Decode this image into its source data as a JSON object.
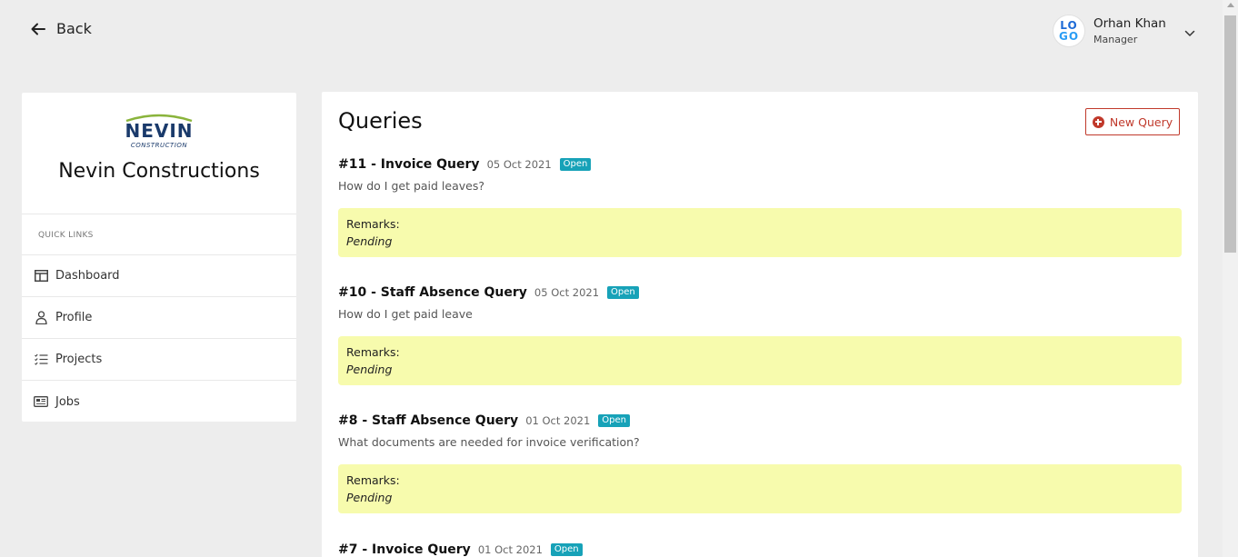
{
  "header": {
    "back_label": "Back",
    "user": {
      "name": "Orhan Khan",
      "role": "Manager",
      "avatar_text_top": "LO",
      "avatar_text_bottom": "GO"
    }
  },
  "sidebar": {
    "brand_logo_text": "NEVIN",
    "brand_logo_subtext": "CONSTRUCTION",
    "brand_name": "Nevin Constructions",
    "quick_links_label": "QUICK LINKS",
    "items": [
      {
        "label": "Dashboard",
        "icon": "dashboard-icon"
      },
      {
        "label": "Profile",
        "icon": "user-icon"
      },
      {
        "label": "Projects",
        "icon": "checklist-icon"
      },
      {
        "label": "Jobs",
        "icon": "newspaper-icon"
      }
    ]
  },
  "main": {
    "title": "Queries",
    "new_query_label": "New Query",
    "queries": [
      {
        "title": "#11 - Invoice Query",
        "date": "05 Oct 2021",
        "status": "Open",
        "text": "How do I get paid leaves?",
        "remarks_label": "Remarks:",
        "remarks_value": "Pending"
      },
      {
        "title": "#10 - Staff Absence Query",
        "date": "05 Oct 2021",
        "status": "Open",
        "text": "How do I get paid leave",
        "remarks_label": "Remarks:",
        "remarks_value": "Pending"
      },
      {
        "title": "#8 - Staff Absence Query",
        "date": "01 Oct 2021",
        "status": "Open",
        "text": "What documents are needed for invoice verification?",
        "remarks_label": "Remarks:",
        "remarks_value": "Pending"
      },
      {
        "title": "#7 - Invoice Query",
        "date": "01 Oct 2021",
        "status": "Open",
        "text": "",
        "remarks_label": "",
        "remarks_value": ""
      }
    ]
  },
  "colors": {
    "background": "#ededed",
    "accent_red": "#c0392b",
    "badge_teal": "#17a2b8",
    "remarks_bg": "#f7fbad",
    "logo_blue": "#1a3a6b",
    "logo_green": "#8ab43c"
  }
}
